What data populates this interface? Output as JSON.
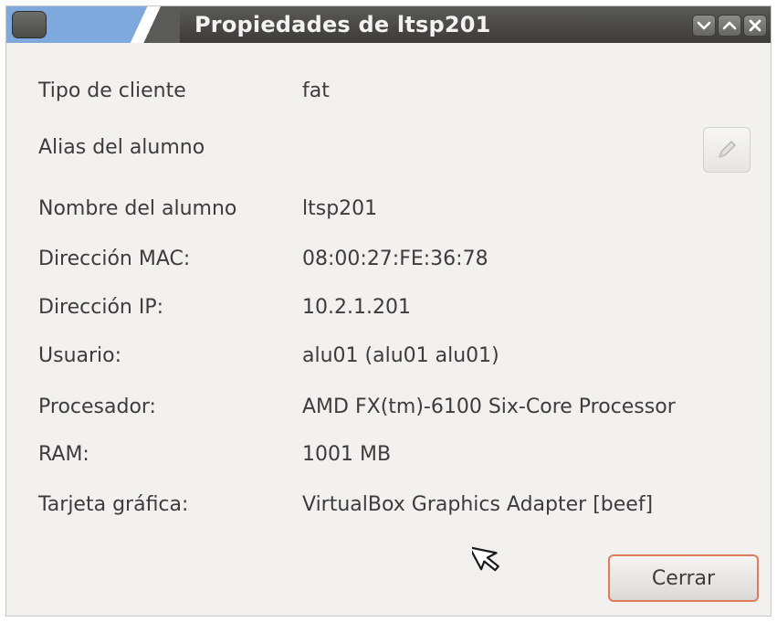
{
  "window": {
    "title": "Propiedades de ltsp201"
  },
  "properties": [
    {
      "label": "Tipo de cliente",
      "value": "fat"
    },
    {
      "label": "Alias del alumno",
      "value": ""
    },
    {
      "label": "Nombre del alumno",
      "value": "ltsp201"
    },
    {
      "label": "Dirección MAC:",
      "value": "08:00:27:FE:36:78"
    },
    {
      "label": "Dirección IP:",
      "value": "10.2.1.201"
    },
    {
      "label": "Usuario:",
      "value": "alu01 (alu01 alu01)"
    },
    {
      "label": "Procesador:",
      "value": "AMD FX(tm)-6100 Six-Core Processor"
    },
    {
      "label": "RAM:",
      "value": "1001 MB"
    },
    {
      "label": "Tarjeta gráfica:",
      "value": "VirtualBox Graphics Adapter [beef]"
    }
  ],
  "buttons": {
    "close_label": "Cerrar",
    "edit_alias_icon": "pencil-icon"
  },
  "titlebar_controls": [
    "minimize-icon",
    "maximize-icon",
    "close-icon"
  ],
  "colors": {
    "titlebar": "#3c3b37",
    "accent": "#e07a57",
    "dialog_bg": "#f2f1f0"
  }
}
